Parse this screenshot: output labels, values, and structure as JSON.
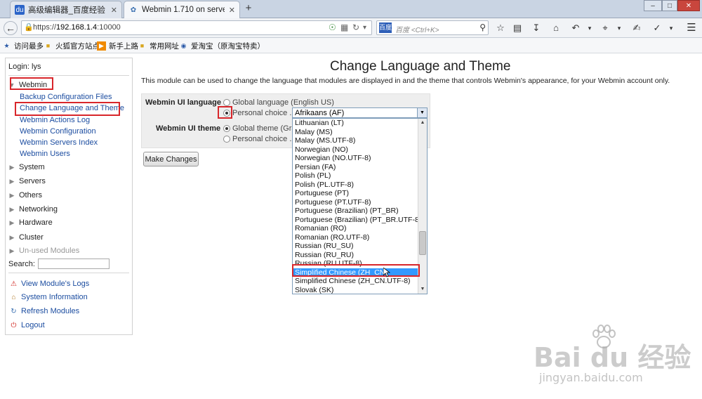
{
  "browser": {
    "tabs": [
      {
        "label": "高级编辑器_百度经验",
        "icon": "baidu-icon",
        "active": false
      },
      {
        "label": "Webmin 1.710 on server...",
        "icon": "webmin-icon",
        "active": true
      }
    ],
    "new_tab": "+",
    "window_controls": [
      "–",
      "□",
      "✕"
    ],
    "url": {
      "scheme": "https://",
      "host": "192.168.1.4",
      "port": ":10000"
    },
    "search_placeholder": "百度 <Ctrl+K>",
    "search_provider": "百度",
    "bookmarks": [
      {
        "label": "访问最多",
        "icon": "star-folder-icon"
      },
      {
        "label": "火狐官方站点",
        "icon": "folder-icon"
      },
      {
        "label": "新手上路",
        "icon": "arrow-icon"
      },
      {
        "label": "常用网址",
        "icon": "folder-icon"
      },
      {
        "label": "爱淘宝（原淘宝特卖）",
        "icon": "taobao-icon"
      }
    ]
  },
  "sidebar": {
    "login": "Login: lys",
    "open_category": "Webmin",
    "modules": [
      "Backup Configuration Files",
      "Change Language and Theme",
      "Webmin Actions Log",
      "Webmin Configuration",
      "Webmin Servers Index",
      "Webmin Users"
    ],
    "categories": [
      "System",
      "Servers",
      "Others",
      "Networking",
      "Hardware",
      "Cluster"
    ],
    "unused": "Un-used Modules",
    "search_label": "Search:",
    "actions": [
      {
        "label": "View Module's Logs",
        "icon": "warning-icon"
      },
      {
        "label": "System Information",
        "icon": "home-icon"
      },
      {
        "label": "Refresh Modules",
        "icon": "refresh-icon"
      },
      {
        "label": "Logout",
        "icon": "logout-icon"
      }
    ]
  },
  "main": {
    "title": "Change Language and Theme",
    "description": "This module can be used to change the language that modules are displayed in and the theme that controls Webmin's appearance, for your Webmin account only.",
    "language_label": "Webmin UI language",
    "language_global": "Global language (English US)",
    "language_personal": "Personal choice ..",
    "selected_language": "Afrikaans (AF)",
    "theme_label": "Webmin UI theme",
    "theme_global": "Global theme (Gray",
    "theme_personal": "Personal choice ..",
    "submit": "Make Changes",
    "language_options": [
      "Lithuanian (LT)",
      "Malay (MS)",
      "Malay (MS.UTF-8)",
      "Norwegian (NO)",
      "Norwegian (NO.UTF-8)",
      "Persian (FA)",
      "Polish (PL)",
      "Polish (PL.UTF-8)",
      "Portuguese (PT)",
      "Portuguese (PT.UTF-8)",
      "Portuguese (Brazilian) (PT_BR)",
      "Portuguese (Brazilian) (PT_BR.UTF-8)",
      "Romanian (RO)",
      "Romanian (RO.UTF-8)",
      "Russian (RU_SU)",
      "Russian (RU_RU)",
      "Russian (RU.UTF-8)",
      "Simplified Chinese (ZH_CN)",
      "Simplified Chinese (ZH_CN.UTF-8)",
      "Slovak (SK)"
    ],
    "highlighted_option": "Simplified Chinese (ZH_CN)"
  },
  "watermark": {
    "logo": "Bai du 经验",
    "url": "jingyan.baidu.com"
  },
  "colors": {
    "link": "#1c4da0",
    "highlight": "#3399ff",
    "annotation": "#d8262b",
    "form_bg": "#eeeeee"
  }
}
